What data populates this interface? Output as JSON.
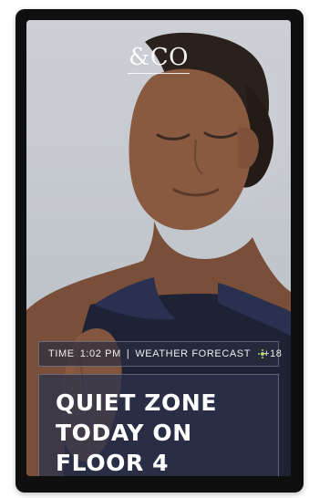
{
  "brand": {
    "logo_text": "&CO"
  },
  "info_bar": {
    "time_label": "TIME",
    "time_value": "1:02 PM",
    "separator": "|",
    "weather_label": "WEATHER FORECAST",
    "weather_icon": "sun-icon",
    "weather_icon_color": "#b6d46b",
    "temperature": "+18"
  },
  "message": {
    "lines": [
      "QUIET ZONE",
      "TODAY ON",
      "FLOOR 4"
    ]
  },
  "colors": {
    "frame": "#0f0f10",
    "panel": "#2d324b",
    "text": "#ffffff"
  }
}
